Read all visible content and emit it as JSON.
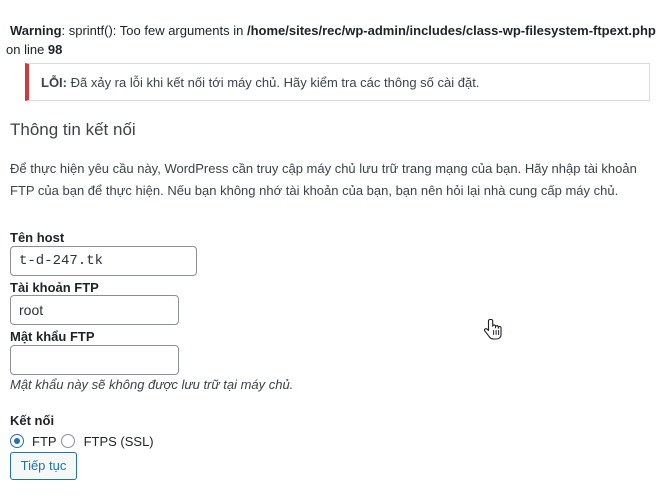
{
  "warning": {
    "prefix": "Warning",
    "message": ": sprintf(): Too few arguments in ",
    "path": "/home/sites/rec/wp-admin/includes/class-wp-filesystem-ftpext.php",
    "line_text": " on line ",
    "line_number": "98"
  },
  "notice": {
    "label": "LỖI:",
    "message": " Đã xảy ra lỗi khi kết nối tới máy chủ. Hãy kiểm tra các thông số cài đặt."
  },
  "section_title": "Thông tin kết nối",
  "description": "Để thực hiện yêu cầu này, WordPress cần truy cập máy chủ lưu trữ trang mạng của bạn. Hãy nhập tài khoản FTP của bạn để thực hiện. Nếu bạn không nhớ tài khoản của bạn, bạn nên hỏi lại nhà cung cấp máy chủ.",
  "form": {
    "host_label": "Tên host",
    "host_value": "t-d-247.tk",
    "user_label": "Tài khoản FTP",
    "user_value": "root",
    "password_label": "Mật khẩu FTP",
    "password_value": "",
    "password_note": "Mật khẩu này sẽ không được lưu trữ tại máy chủ.",
    "connection_label": "Kết nối",
    "options": [
      {
        "label": "FTP",
        "selected": "true"
      },
      {
        "label": "FTPS (SSL)",
        "selected": "false"
      }
    ],
    "submit_label": "Tiếp tục"
  },
  "colors": {
    "error": "#d63638",
    "accent": "#2271b1"
  },
  "icons": {
    "cursor": "hand-pointer-icon"
  }
}
